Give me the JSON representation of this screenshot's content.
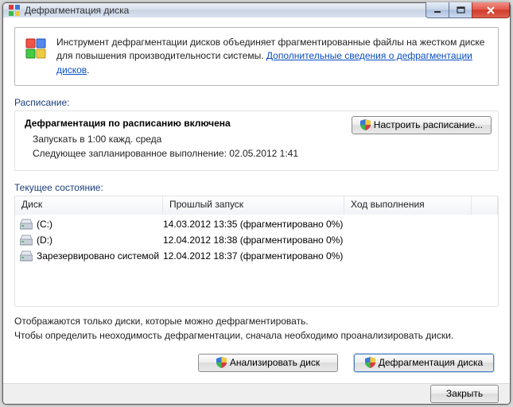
{
  "titlebar": {
    "title": "Дефрагментация диска"
  },
  "info": {
    "text1": "Инструмент дефрагментации дисков объединяет фрагментированные файлы на жестком диске для повышения производительности системы. ",
    "link": "Дополнительные сведения о дефрагментации дисков",
    "link_suffix": "."
  },
  "schedule": {
    "label": "Расписание:",
    "title": "Дефрагментация по расписанию включена",
    "line1": "Запускать в 1:00 кажд. среда",
    "line2": "Следующее запланированное выполнение: 02.05.2012 1:41",
    "config_btn": "Настроить расписание..."
  },
  "current": {
    "label": "Текущее состояние:",
    "headers": {
      "c1": "Диск",
      "c2": "Прошлый запуск",
      "c3": "Ход выполнения"
    },
    "rows": [
      {
        "name": "(C:)",
        "last": "14.03.2012 13:35 (фрагментировано 0%)",
        "progress": "",
        "icon": "hdd"
      },
      {
        "name": "(D:)",
        "last": "12.04.2012 18:38 (фрагментировано 0%)",
        "progress": "",
        "icon": "hdd"
      },
      {
        "name": "Зарезервировано системой",
        "last": "12.04.2012 18:37 (фрагментировано 0%)",
        "progress": "",
        "icon": "hdd"
      }
    ]
  },
  "hint": {
    "line1": "Отображаются только диски, которые можно дефрагментировать.",
    "line2": "Чтобы определить неоходимость  дефрагментации, сначала необходимо проанализировать диски."
  },
  "buttons": {
    "analyze": "Анализировать диск",
    "defrag": "Дефрагментация диска",
    "close": "Закрыть"
  }
}
